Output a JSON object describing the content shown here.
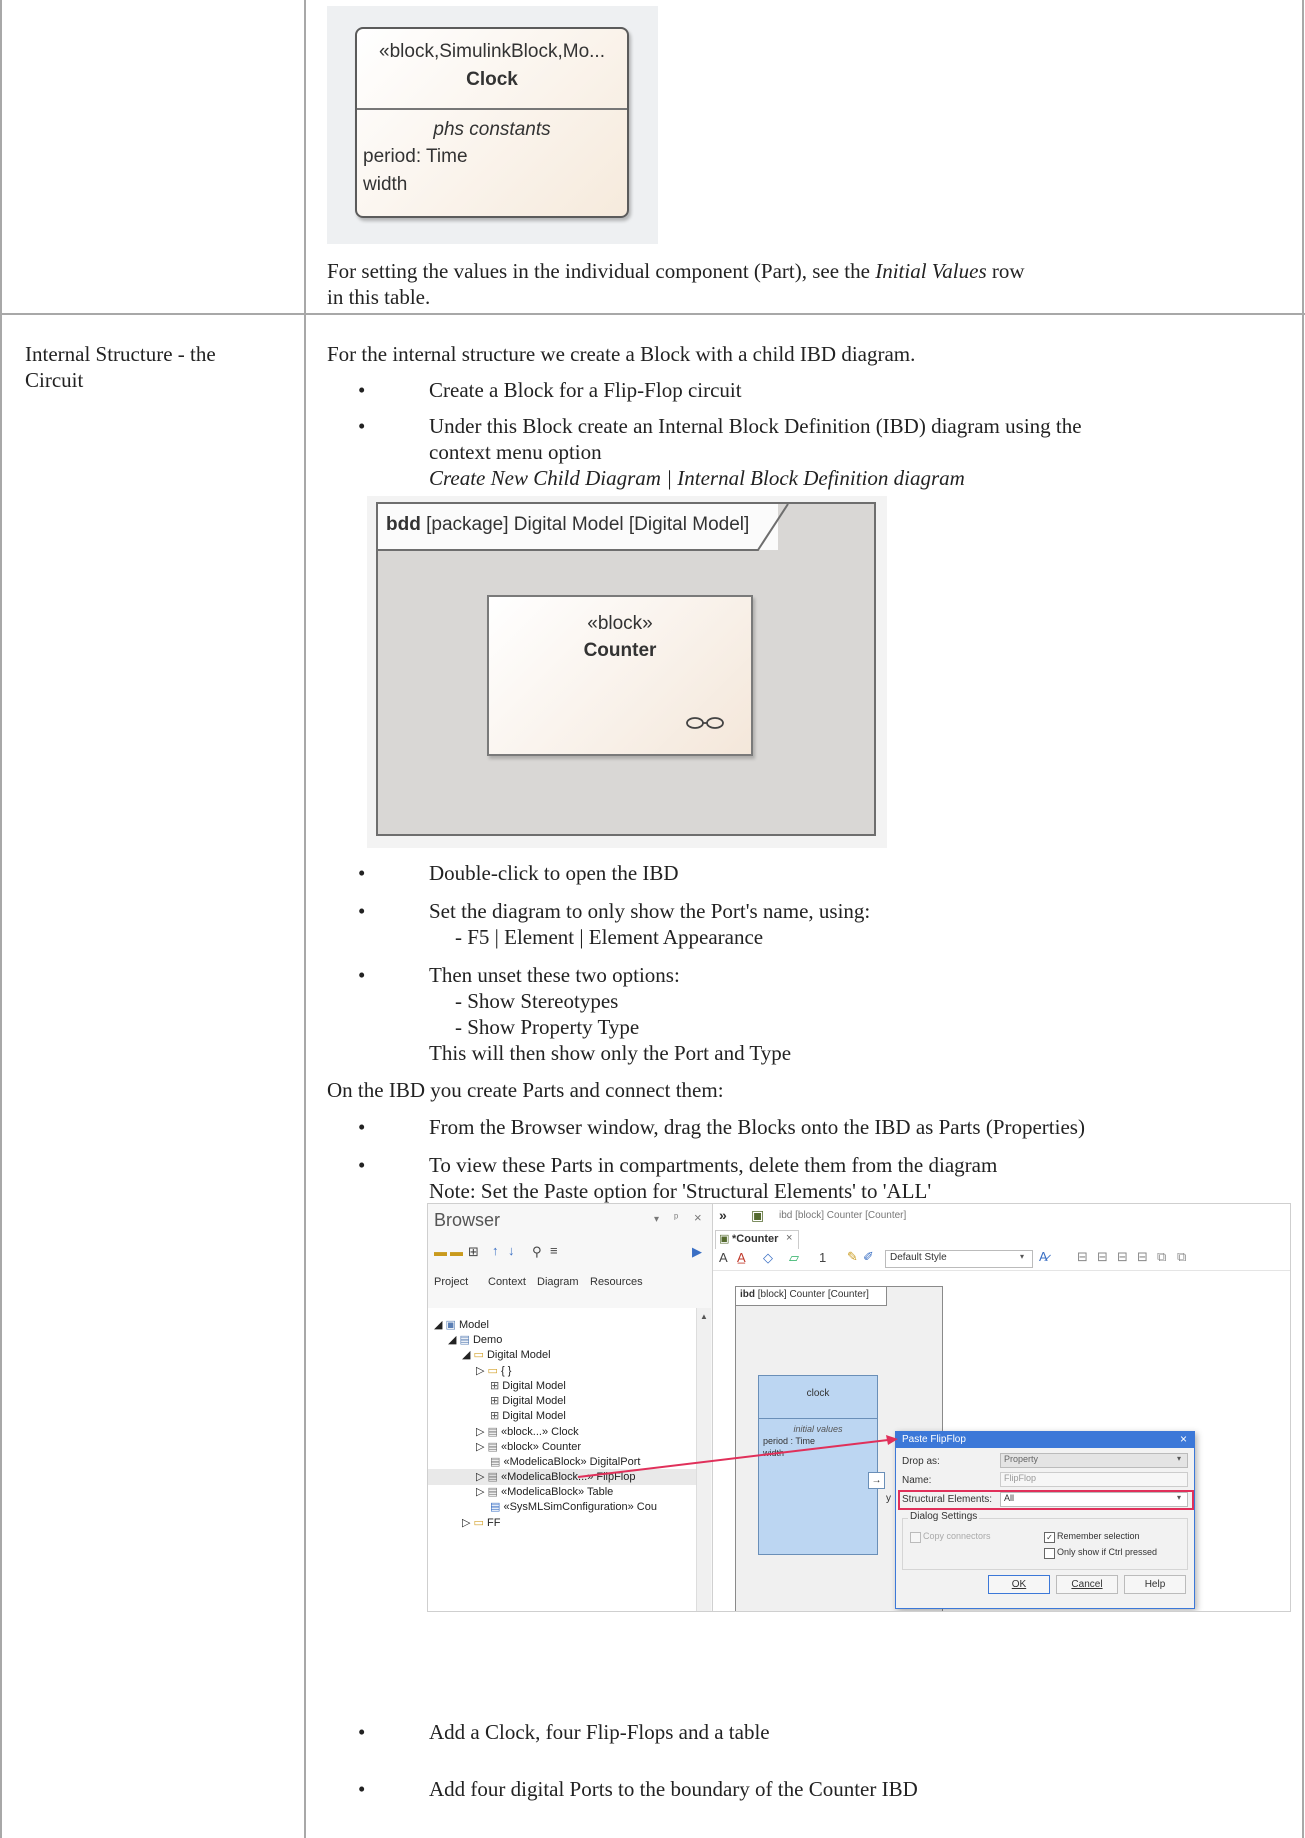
{
  "row1": {
    "clock_block": {
      "stereotype": "«block,SimulinkBlock,Mo...",
      "name": "Clock",
      "compartment": "phs constants",
      "attrs": [
        "period: Time",
        "width"
      ]
    },
    "text_before": "For setting the values in the individual component (Part), see the ",
    "text_italic": "Initial Values",
    "text_after": " row",
    "text_line2": "in this table."
  },
  "row2": {
    "label_line1": "Internal Structure - the",
    "label_line2": "Circuit",
    "intro": "For the internal structure we create a Block with a child IBD diagram.",
    "bullets1": [
      "Create a Block for a Flip-Flop circuit",
      "Under this Block create an Internal Block Definition (IBD) diagram using the",
      "context menu option",
      "Create New Child Diagram | Internal Block Definition diagram"
    ],
    "bdd": {
      "kw": "bdd",
      "title": " [package] Digital Model [Digital Model]",
      "stereotype": "«block»",
      "name": "Counter"
    },
    "bullets2": [
      "Double-click to open the IBD",
      "Set the diagram to only show the Port's name, using:",
      "- F5 | Element | Element Appearance",
      "Then unset these two options:",
      "- Show Stereotypes",
      "- Show Property Type",
      "This will then show only the Port and Type"
    ],
    "parts_intro": "On the IBD you create Parts and connect them:",
    "bullets3": [
      "From the Browser window, drag the Blocks onto the IBD as Parts (Properties)",
      "To view these Parts in compartments, delete them from the diagram",
      "Note: Set the Paste option for 'Structural Elements' to 'ALL'"
    ],
    "bullets4": [
      "Add a Clock, four Flip-Flops and a table",
      "Add four digital Ports to the boundary of the Counter IBD"
    ]
  },
  "screenshot": {
    "browser_title": "Browser",
    "browser_tabs": [
      "Project",
      "Context",
      "Diagram",
      "Resources"
    ],
    "tree": [
      "Model",
      "Demo",
      "Digital Model",
      "{ }",
      "Digital Model",
      "Digital Model",
      "Digital Model",
      "«block...» Clock",
      "«block» Counter",
      "«ModelicaBlock» DigitalPort",
      "«ModelicaBlock...» FlipFlop",
      "«ModelicaBlock» Table",
      "«SysMLSimConfiguration» Cou",
      "FF"
    ],
    "path_text": "ibd [block] Counter [Counter]",
    "doc_tab": "*Counter",
    "style_select": "Default Style",
    "ibd_kw": "ibd",
    "ibd_title": " [block] Counter [Counter]",
    "part_name": "clock",
    "part_compartment": "initial values",
    "part_attrs": [
      "period : Time",
      "width"
    ],
    "port_label": "y",
    "dialog": {
      "title": "Paste FlipFlop",
      "drop_as_label": "Drop as:",
      "drop_as_value": "Property",
      "name_label": "Name:",
      "name_value": "FlipFlop",
      "struct_label": "Structural Elements:",
      "struct_value": "All",
      "settings_label": "Dialog Settings",
      "copy_connectors": "Copy connectors",
      "remember": "Remember selection",
      "only_show": "Only show if Ctrl pressed",
      "ok": "OK",
      "cancel": "Cancel",
      "help": "Help"
    },
    "colors": {
      "dialog_title_bg": "#3c78d8",
      "highlight": "#e0305a",
      "part_bg": "#bcd6f2"
    }
  }
}
